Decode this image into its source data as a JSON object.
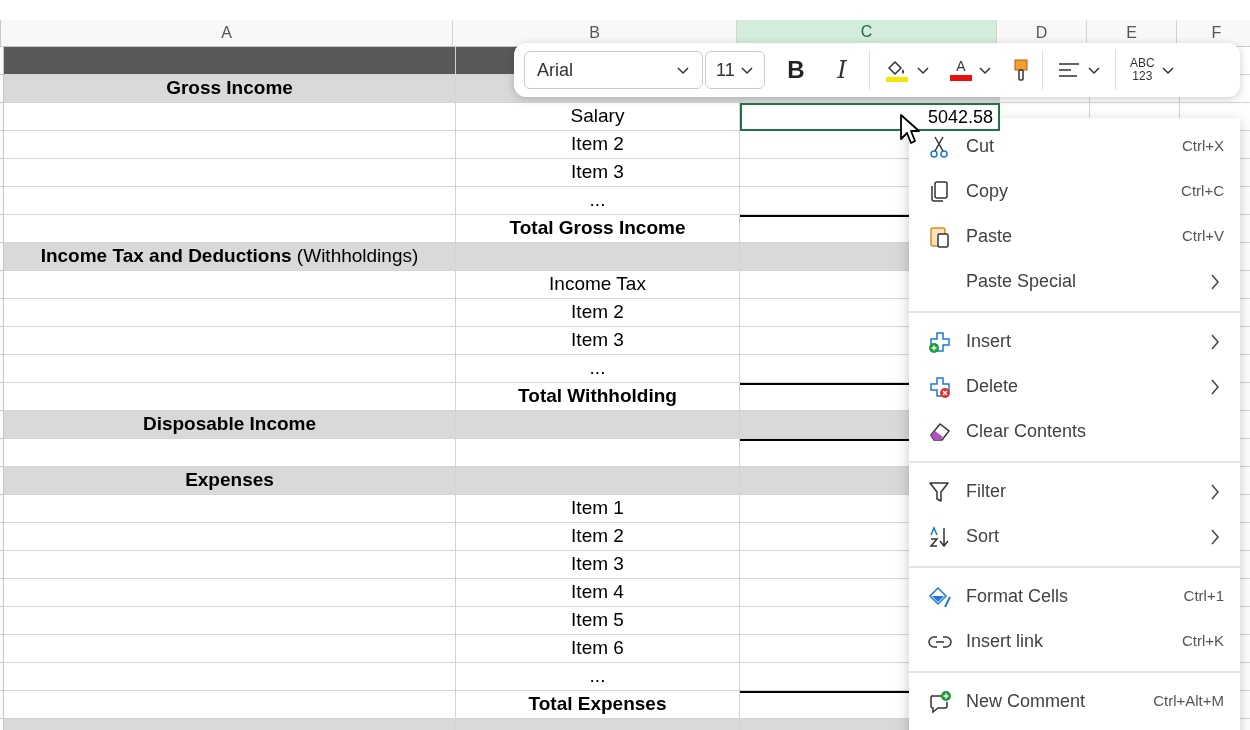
{
  "columns": [
    {
      "label": "A",
      "selected": false
    },
    {
      "label": "B",
      "selected": false
    },
    {
      "label": "C",
      "selected": true
    },
    {
      "label": "D",
      "selected": false
    },
    {
      "label": "E",
      "selected": false
    },
    {
      "label": "F",
      "selected": false
    }
  ],
  "rows": [
    {
      "kind": "band",
      "rule_above": false,
      "selected": false
    },
    {
      "kind": "section",
      "label": "Gross Income",
      "rule_above": false,
      "selected": false
    },
    {
      "kind": "item",
      "label": "Salary",
      "value": "5042.58",
      "rule_above": false,
      "selected": true
    },
    {
      "kind": "item",
      "label": "Item 2",
      "rule_above": false,
      "selected": false
    },
    {
      "kind": "item",
      "label": "Item 3",
      "rule_above": false,
      "selected": false
    },
    {
      "kind": "item",
      "label": "...",
      "rule_above": false,
      "selected": false
    },
    {
      "kind": "total",
      "label": "Total Gross Income",
      "rule_above": true,
      "selected": false
    },
    {
      "kind": "section",
      "label": "Income Tax and Deductions",
      "note": "(Withholdings)",
      "rule_above": false,
      "selected": false
    },
    {
      "kind": "item",
      "label": "Income Tax",
      "rule_above": false,
      "selected": false
    },
    {
      "kind": "item",
      "label": "Item 2",
      "rule_above": false,
      "selected": false
    },
    {
      "kind": "item",
      "label": "Item 3",
      "rule_above": false,
      "selected": false
    },
    {
      "kind": "item",
      "label": "...",
      "rule_above": false,
      "selected": false
    },
    {
      "kind": "total",
      "label": "Total Withholding",
      "rule_above": true,
      "selected": false
    },
    {
      "kind": "section",
      "label": "Disposable Income",
      "rule_above": false,
      "selected": false
    },
    {
      "kind": "blank",
      "rule_above": true,
      "selected": false
    },
    {
      "kind": "section",
      "label": "Expenses",
      "rule_above": false,
      "selected": false
    },
    {
      "kind": "item",
      "label": "Item 1",
      "rule_above": false,
      "selected": false
    },
    {
      "kind": "item",
      "label": "Item 2",
      "rule_above": false,
      "selected": false
    },
    {
      "kind": "item",
      "label": "Item 3",
      "rule_above": false,
      "selected": false
    },
    {
      "kind": "item",
      "label": "Item 4",
      "rule_above": false,
      "selected": false
    },
    {
      "kind": "item",
      "label": "Item 5",
      "rule_above": false,
      "selected": false
    },
    {
      "kind": "item",
      "label": "Item 6",
      "rule_above": false,
      "selected": false
    },
    {
      "kind": "item",
      "label": "...",
      "rule_above": false,
      "selected": false
    },
    {
      "kind": "total",
      "label": "Total Expenses",
      "rule_above": true,
      "selected": false
    },
    {
      "kind": "section",
      "rule_above": false,
      "selected": false
    }
  ],
  "toolbar": {
    "font": "Arial",
    "size": "11",
    "bold_glyph": "B",
    "italic_glyph": "I",
    "font_color_glyph": "A",
    "number_format_lines": [
      "ABC",
      "123"
    ]
  },
  "context_menu": [
    {
      "kind": "item",
      "label": "Cut",
      "shortcut": "Ctrl+X",
      "submenu": false
    },
    {
      "kind": "item",
      "label": "Copy",
      "shortcut": "Ctrl+C",
      "submenu": false
    },
    {
      "kind": "item",
      "label": "Paste",
      "shortcut": "Ctrl+V",
      "submenu": false
    },
    {
      "kind": "item",
      "label": "Paste Special",
      "submenu": true
    },
    {
      "kind": "separator"
    },
    {
      "kind": "item",
      "label": "Insert",
      "submenu": true
    },
    {
      "kind": "item",
      "label": "Delete",
      "submenu": true
    },
    {
      "kind": "item",
      "label": "Clear Contents",
      "submenu": false
    },
    {
      "kind": "separator"
    },
    {
      "kind": "item",
      "label": "Filter",
      "submenu": true
    },
    {
      "kind": "item",
      "label": "Sort",
      "submenu": true
    },
    {
      "kind": "separator"
    },
    {
      "kind": "item",
      "label": "Format Cells",
      "shortcut": "Ctrl+1",
      "submenu": false
    },
    {
      "kind": "item",
      "label": "Insert link",
      "shortcut": "Ctrl+K",
      "submenu": false
    },
    {
      "kind": "separator"
    },
    {
      "kind": "item",
      "label": "New Comment",
      "shortcut": "Ctrl+Alt+M",
      "submenu": false
    }
  ]
}
